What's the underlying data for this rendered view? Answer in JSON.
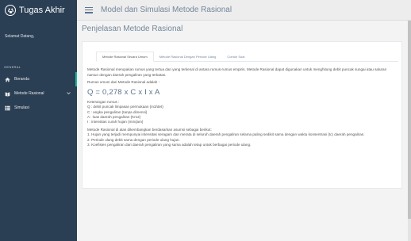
{
  "app": {
    "title": "Tugas Akhir"
  },
  "sidebar": {
    "welcome": "Selamat Datang,",
    "section": "GENERAL",
    "items": [
      {
        "label": "Beranda",
        "icon": "home-icon"
      },
      {
        "label": "Metode Rasional",
        "icon": "book-icon"
      },
      {
        "label": "Simulasi",
        "icon": "table-icon"
      }
    ]
  },
  "header": {
    "title": "Model dan Simulasi Metode Rasional"
  },
  "main": {
    "page_title": "Penjelasan Metode Rasional",
    "tabs": [
      {
        "label": "Metode Rasional Secara Umum"
      },
      {
        "label": "Metode Rasional Dengan Periode Ulang"
      },
      {
        "label": "Contoh Soal"
      }
    ],
    "content": {
      "intro": "Metode Rasional merupakan rumus yang tertua dan yang terkenal di antara rumus-rumus empiris. Metode Rasional dapat digunakan untuk menghitung debit puncak sungai atau saluran namun dengan daerah pengaliran yang terbatas.",
      "formula_intro": "Rumus umum dari Metode Rasional adalah :",
      "formula": "Q = 0,278 x C x I x A",
      "legend_title": "Keterangan rumus :",
      "legend": [
        "Q : debit puncak limpasan permukaan (m3/det)",
        "C : angka pengaliran (tanpa dimensi)",
        "A : luas daerah pengaliran (Km2)",
        "I : intensitas curah hujan (mm/jam)"
      ],
      "assumption_intro": "Metode Rasional di atas dikembangkan berdasarkan asumsi sebagai berikut:",
      "assumptions": [
        "1. Hujan yang terjadi mempunyai intensitas seragam dan merata di seluruh daerah pengaliran selama paling sedikit sama dengan waktu konsentrasi (tc) daerah pengaliran.",
        "2. Periode ulang debit sama dengan periode ulang hujan.",
        "3. Koefisien pengaliran dari daerah pengaliran yang sama adalah tetap untuk berbagai periode ulang."
      ]
    }
  },
  "colors": {
    "sidebar_bg": "#2a3f54",
    "accent": "#1abb9c",
    "title_text": "#73879c"
  }
}
